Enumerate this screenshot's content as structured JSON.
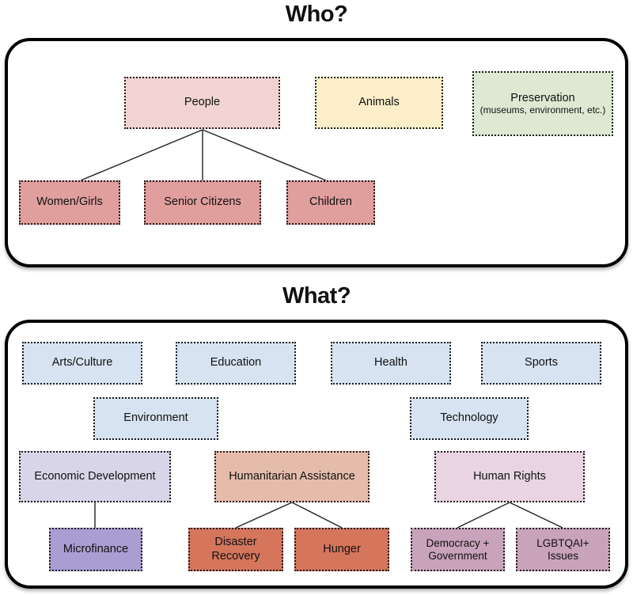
{
  "sections": [
    {
      "id": "who",
      "title": "Who?",
      "nodes": [
        {
          "key": "people",
          "label": "People",
          "color": "#f1d4d2"
        },
        {
          "key": "animals",
          "label": "Animals",
          "color": "#fbeec9"
        },
        {
          "key": "preservation",
          "label": "Preservation",
          "sub": "(museums, environment, etc.)",
          "color": "#dde9d3"
        },
        {
          "key": "women_girls",
          "label": "Women/Girls",
          "color": "#e09e9c"
        },
        {
          "key": "senior_citizens",
          "label": "Senior Citizens",
          "color": "#e09e9c"
        },
        {
          "key": "children",
          "label": "Children",
          "color": "#e09e9c"
        }
      ],
      "edges": [
        {
          "from": "people",
          "to": "women_girls"
        },
        {
          "from": "people",
          "to": "senior_citizens"
        },
        {
          "from": "people",
          "to": "children"
        }
      ]
    },
    {
      "id": "what",
      "title": "What?",
      "nodes": [
        {
          "key": "arts_culture",
          "label": "Arts/Culture",
          "color": "#d7e3f0"
        },
        {
          "key": "education",
          "label": "Education",
          "color": "#d7e3f0"
        },
        {
          "key": "health",
          "label": "Health",
          "color": "#d7e3f0"
        },
        {
          "key": "sports",
          "label": "Sports",
          "color": "#d7e3f0"
        },
        {
          "key": "environment",
          "label": "Environment",
          "color": "#d7e3f0"
        },
        {
          "key": "technology",
          "label": "Technology",
          "color": "#d7e3f0"
        },
        {
          "key": "economic_dev",
          "label": "Economic Development",
          "color": "#d9d5e8"
        },
        {
          "key": "humanitarian",
          "label": "Humanitarian Assistance",
          "color": "#e5bcab"
        },
        {
          "key": "human_rights",
          "label": "Human Rights",
          "color": "#e8d5e1"
        },
        {
          "key": "microfinance",
          "label": "Microfinance",
          "color": "#a99dd1"
        },
        {
          "key": "disaster_recovery",
          "label": "Disaster Recovery",
          "color": "#d4755c"
        },
        {
          "key": "hunger",
          "label": "Hunger",
          "color": "#d4755c"
        },
        {
          "key": "democracy_gov",
          "label": "Democracy + Government",
          "color": "#c9a2bb"
        },
        {
          "key": "lgbtqai_issues",
          "label": "LGBTQAI+ Issues",
          "color": "#c9a2bb"
        }
      ],
      "edges": [
        {
          "from": "economic_dev",
          "to": "microfinance"
        },
        {
          "from": "humanitarian",
          "to": "disaster_recovery"
        },
        {
          "from": "humanitarian",
          "to": "hunger"
        },
        {
          "from": "human_rights",
          "to": "democracy_gov"
        },
        {
          "from": "human_rights",
          "to": "lgbtqai_issues"
        }
      ]
    }
  ],
  "labels": {
    "people": "People",
    "animals": "Animals",
    "preservation_main": "Preservation",
    "preservation_sub": "(museums, environment, etc.)",
    "women_girls": "Women/Girls",
    "senior_citizens": "Senior Citizens",
    "children": "Children",
    "arts_culture": "Arts/Culture",
    "education": "Education",
    "health": "Health",
    "sports": "Sports",
    "environment": "Environment",
    "technology": "Technology",
    "economic_development": "Economic Development",
    "humanitarian_assistance": "Humanitarian Assistance",
    "human_rights": "Human Rights",
    "microfinance": "Microfinance",
    "disaster_recovery": "Disaster Recovery",
    "hunger": "Hunger",
    "democracy_government": "Democracy + Government",
    "lgbtqai_issues": "LGBTQAI+ Issues"
  },
  "colors": {
    "people": "#f1d4d2",
    "animals": "#fbeec9",
    "preservation": "#dde9d3",
    "people_children": "#e09e9c",
    "topic_blue": "#d7e3f0",
    "economic": "#d9d5e8",
    "microfinance": "#a99dd1",
    "humanitarian": "#e5bcab",
    "disaster": "#d4755c",
    "human_rights": "#e8d5e1",
    "rights_child": "#c9a2bb",
    "panel_border": "#000000",
    "node_border": "#1a1a1a",
    "connector": "#222222"
  }
}
